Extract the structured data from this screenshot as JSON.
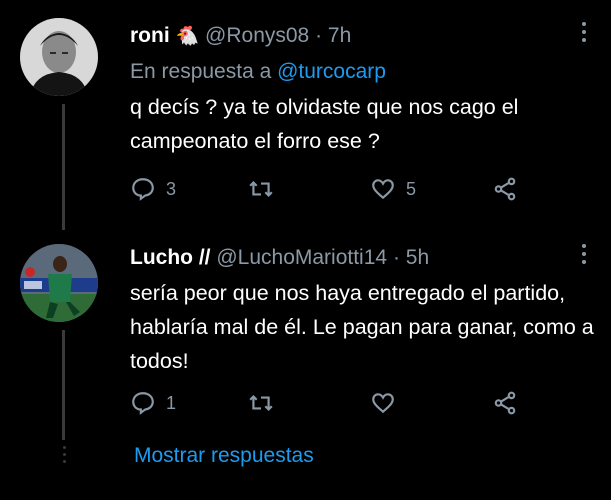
{
  "tweets": [
    {
      "name": "roni",
      "emoji": "🐔",
      "handle": "@Ronys08",
      "time": "· 7h",
      "reply_prefix": "En respuesta a ",
      "reply_handle": "@turcocarp",
      "text": "q decís ? ya te olvidaste que nos cago el campeonato el forro ese ?",
      "replies": "3",
      "retweets": "",
      "likes": "5"
    },
    {
      "name": "Lucho //",
      "handle": "@LuchoMariotti14",
      "time": "· 5h",
      "text": "sería peor que nos haya entregado el partido, hablaría mal de él. Le pagan para ganar, como a todos!",
      "replies": "1",
      "retweets": "",
      "likes": ""
    }
  ],
  "show_replies": "Mostrar respuestas",
  "icons": [
    "comment-icon",
    "retweet-icon",
    "heart-icon",
    "share-icon",
    "more-icon"
  ],
  "colors": {
    "background": "#000000",
    "link": "#1d9bf0",
    "secondary": "#8b98a5"
  }
}
